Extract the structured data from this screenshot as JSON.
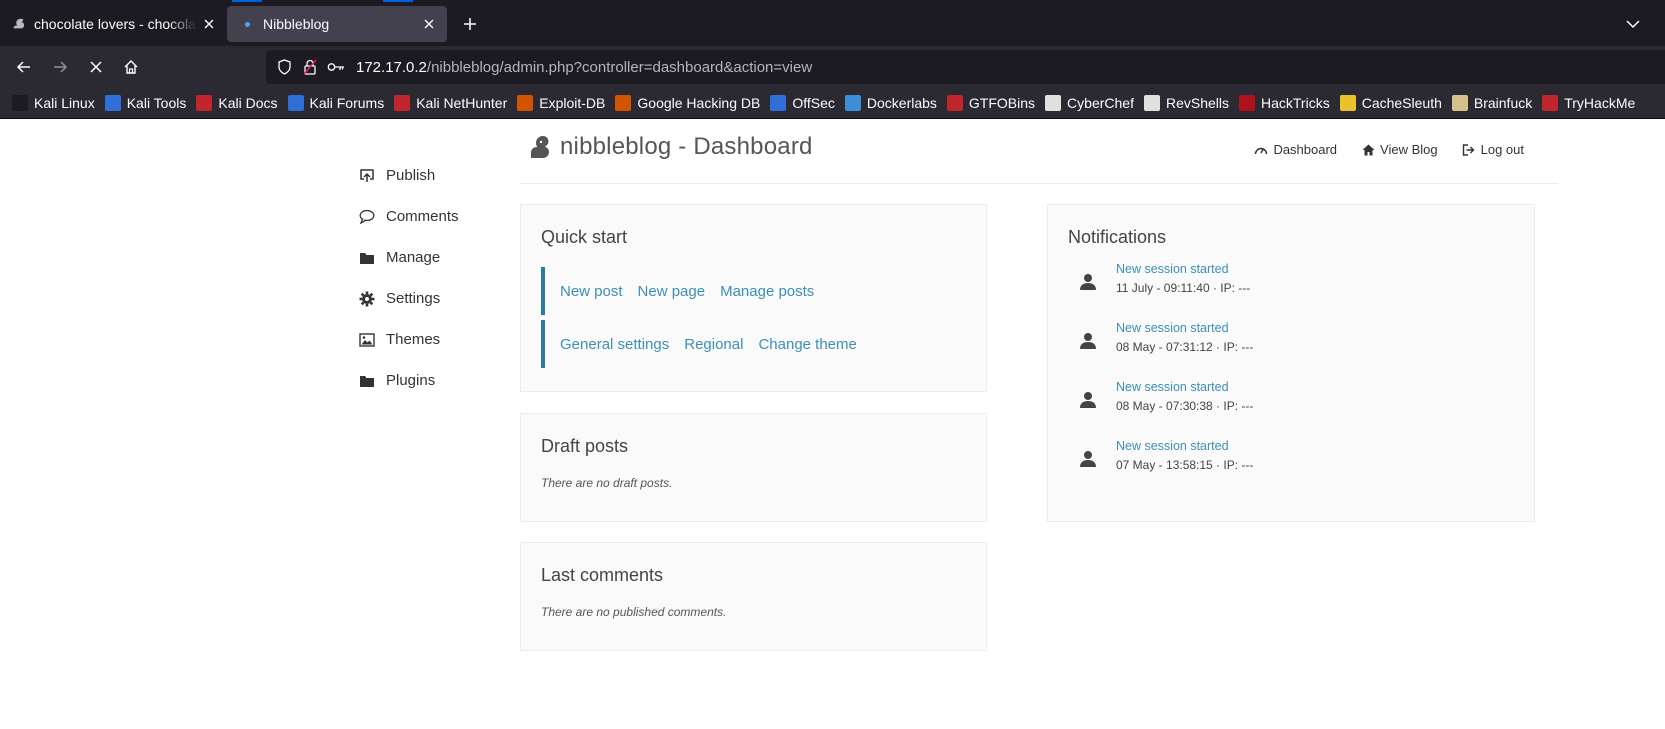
{
  "browser": {
    "tabs": [
      {
        "title": "chocolate lovers - chocolate lovers",
        "active": false
      },
      {
        "title": "Nibbleblog",
        "active": true
      }
    ],
    "url_host": "172.17.0.2",
    "url_path": "/nibbleblog/admin.php?controller=dashboard&action=view",
    "bookmarks": [
      {
        "label": "Kali Linux",
        "icon": "kali-dragon-icon",
        "color": "#1c1b22"
      },
      {
        "label": "Kali Tools",
        "icon": "kali-tools-icon",
        "color": "#2e6fd8"
      },
      {
        "label": "Kali Docs",
        "icon": "kali-docs-icon",
        "color": "#c0262b"
      },
      {
        "label": "Kali Forums",
        "icon": "kali-forums-icon",
        "color": "#2e6fd8"
      },
      {
        "label": "Kali NetHunter",
        "icon": "nethunter-icon",
        "color": "#c0262b"
      },
      {
        "label": "Exploit-DB",
        "icon": "exploit-db-icon",
        "color": "#d35400"
      },
      {
        "label": "Google Hacking DB",
        "icon": "ghdb-icon",
        "color": "#d35400"
      },
      {
        "label": "OffSec",
        "icon": "offsec-icon",
        "color": "#2e6fd8"
      },
      {
        "label": "Dockerlabs",
        "icon": "dockerlabs-icon",
        "color": "#3a8fd8"
      },
      {
        "label": "GTFOBins",
        "icon": "gtfobins-icon",
        "color": "#c0262b"
      },
      {
        "label": "CyberChef",
        "icon": "cyberchef-icon",
        "color": "#e0e0e0"
      },
      {
        "label": "RevShells",
        "icon": "revshells-icon",
        "color": "#e0e0e0"
      },
      {
        "label": "HackTricks",
        "icon": "hacktricks-icon",
        "color": "#b0121b"
      },
      {
        "label": "CacheSleuth",
        "icon": "cachesleuth-icon",
        "color": "#e8c22a"
      },
      {
        "label": "Brainfuck",
        "icon": "brainfuck-icon",
        "color": "#d8c08a"
      },
      {
        "label": "TryHackMe",
        "icon": "tryhackme-icon",
        "color": "#c0262b"
      }
    ]
  },
  "site": {
    "logo_text": "nibbleblog - Dashboard",
    "topnav": {
      "dashboard": "Dashboard",
      "view_blog": "View Blog",
      "logout": "Log out"
    },
    "sidebar": [
      "Publish",
      "Comments",
      "Manage",
      "Settings",
      "Themes",
      "Plugins"
    ]
  },
  "quick_start": {
    "title": "Quick start",
    "row1": [
      "New post",
      "New page",
      "Manage posts"
    ],
    "row2": [
      "General settings",
      "Regional",
      "Change theme"
    ]
  },
  "draft_posts": {
    "title": "Draft posts",
    "empty": "There are no draft posts."
  },
  "last_comments": {
    "title": "Last comments",
    "empty": "There are no published comments."
  },
  "notifications": {
    "title": "Notifications",
    "items": [
      {
        "title": "New session started",
        "date": "11 July - 09:11:40 · IP: ---"
      },
      {
        "title": "New session started",
        "date": "08 May - 07:31:12 · IP: ---"
      },
      {
        "title": "New session started",
        "date": "08 May - 07:30:38 · IP: ---"
      },
      {
        "title": "New session started",
        "date": "07 May - 13:58:15 · IP: ---"
      }
    ]
  }
}
